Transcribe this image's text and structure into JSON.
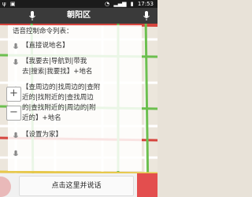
{
  "status_bar": {
    "left_icons": [
      "usb-icon",
      "notification-icon"
    ],
    "right_icons": [
      "wifi-icon",
      "signal-icon",
      "battery-icon"
    ],
    "time": "17:53"
  },
  "title_bar": {
    "title": "朝阳区"
  },
  "help_panel": {
    "lines": [
      "语音控制命令列表：",
      "【直接说地名】",
      "【我要去|导航到|带我",
      "去|搜索|我要找】+地名",
      "【查周边的|找周边的|查附",
      "近的|找附近的|查找周边",
      "的|查找附近的|周边的|附",
      "近的】+地名",
      "【设置为家】"
    ]
  },
  "map_controls": {
    "zoom_in_label": "+",
    "zoom_out_label": "−"
  },
  "bottom_bar": {
    "speak_label": "点击这里并说话"
  },
  "colors": {
    "title_bar": "#3a3a3a",
    "accent_red": "#e34e4e",
    "road_green": "#6cbf4f",
    "road_red": "#d6453e"
  }
}
